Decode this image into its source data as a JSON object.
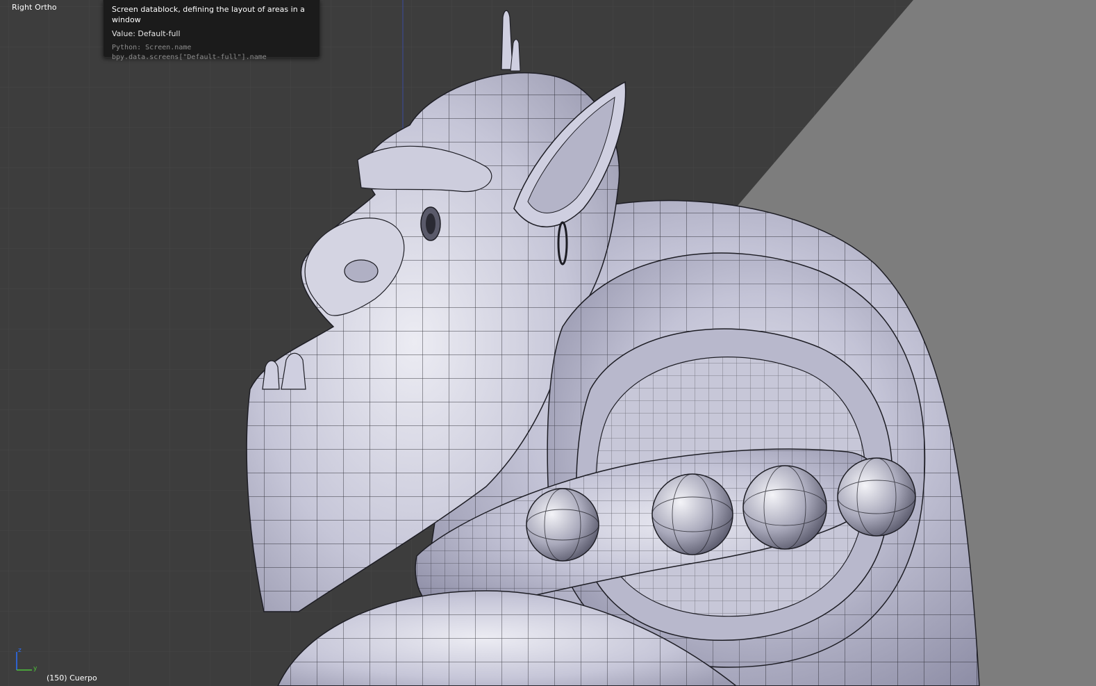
{
  "viewport": {
    "view_name": "Right Ortho",
    "object_info": "(150) Cuerpo",
    "background_color": "#3d3d3d",
    "grid_color": "#464646",
    "mesh_color": "#c4c4d8",
    "wire_color": "#1a1a1a",
    "axis_gizmo": {
      "z_label": "z",
      "y_label": "y",
      "z_color": "#2a6fff",
      "y_color": "#4ec23b"
    }
  },
  "tooltip": {
    "title": "Screen datablock, defining the layout of areas in a window",
    "value": "Value: Default-full",
    "python": "Python: Screen.name",
    "path": "bpy.data.screens[\"Default-full\"].name"
  }
}
